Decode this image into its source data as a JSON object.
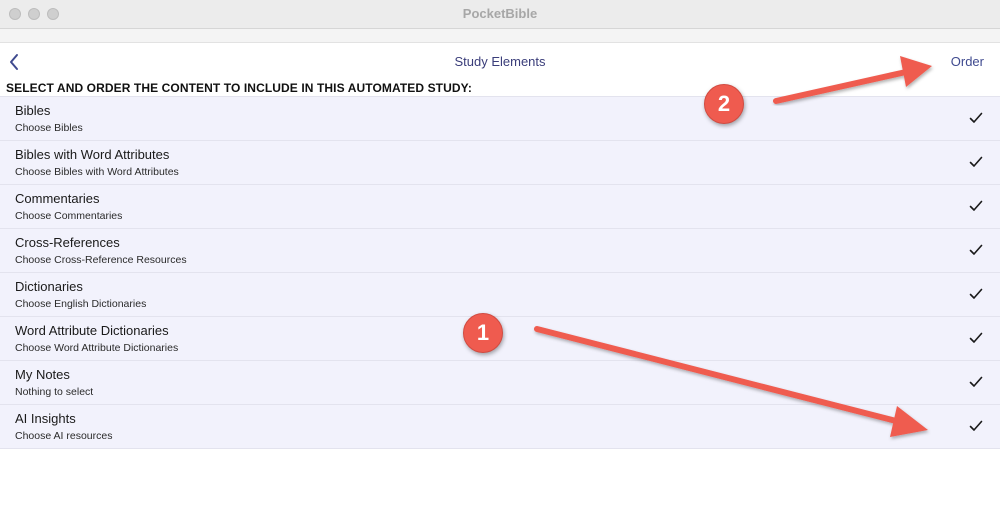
{
  "window": {
    "app_title": "PocketBible"
  },
  "navbar": {
    "title": "Study Elements",
    "order_label": "Order"
  },
  "section_header": "SELECT AND ORDER THE CONTENT TO INCLUDE IN THIS AUTOMATED STUDY:",
  "items": [
    {
      "title": "Bibles",
      "subtitle": "Choose Bibles",
      "checked": true
    },
    {
      "title": "Bibles with Word Attributes",
      "subtitle": "Choose Bibles with Word Attributes",
      "checked": true
    },
    {
      "title": "Commentaries",
      "subtitle": "Choose Commentaries",
      "checked": true
    },
    {
      "title": "Cross-References",
      "subtitle": "Choose Cross-Reference Resources",
      "checked": true
    },
    {
      "title": "Dictionaries",
      "subtitle": "Choose English Dictionaries",
      "checked": true
    },
    {
      "title": "Word Attribute Dictionaries",
      "subtitle": "Choose Word Attribute Dictionaries",
      "checked": true
    },
    {
      "title": "My Notes",
      "subtitle": "Nothing to select",
      "checked": true
    },
    {
      "title": "AI Insights",
      "subtitle": "Choose AI resources",
      "checked": true
    }
  ],
  "annotations": {
    "badge_1": "1",
    "badge_2": "2"
  },
  "colors": {
    "accent": "#3f4a8f",
    "row_background": "#f2f2fc",
    "annotation": "#ef5b4f"
  },
  "icons": {
    "back": "chevron-left-icon",
    "check": "checkmark-icon"
  }
}
